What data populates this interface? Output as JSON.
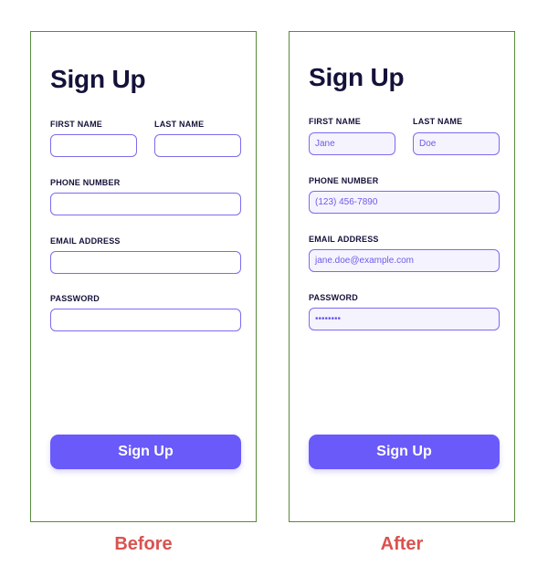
{
  "before": {
    "title": "Sign Up",
    "first_name_label": "FIRST NAME",
    "first_name_value": "",
    "last_name_label": "LAST NAME",
    "last_name_value": "",
    "phone_label": "PHONE NUMBER",
    "phone_value": "",
    "email_label": "EMAIL ADDRESS",
    "email_value": "",
    "password_label": "PASSWORD",
    "password_value": "",
    "submit_label": "Sign Up",
    "caption": "Before"
  },
  "after": {
    "title": "Sign Up",
    "first_name_label": "FIRST NAME",
    "first_name_value": "Jane",
    "last_name_label": "LAST NAME",
    "last_name_value": "Doe",
    "phone_label": "PHONE NUMBER",
    "phone_value": "(123) 456-7890",
    "email_label": "EMAIL ADDRESS",
    "email_value": "jane.doe@example.com",
    "password_label": "PASSWORD",
    "password_value": "••••••••",
    "submit_label": "Sign Up",
    "caption": "After"
  },
  "colors": {
    "accent": "#6a5af9",
    "input_border": "#7b6cf0",
    "input_text": "#6c5ce7",
    "filled_input_bg": "#f5f3fe",
    "title_text": "#14123a",
    "caption_text": "#d9534f",
    "panel_border": "#5a8a3c"
  }
}
